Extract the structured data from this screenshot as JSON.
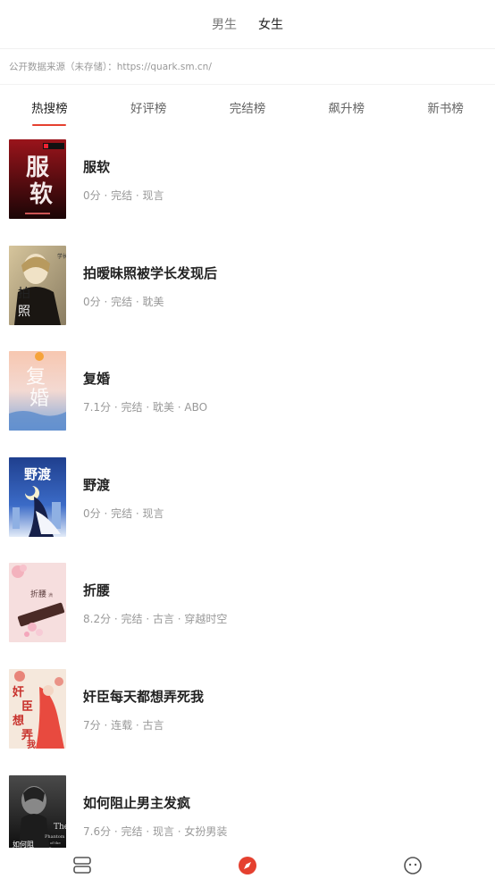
{
  "gender_tabs": [
    {
      "label": "男生",
      "active": false
    },
    {
      "label": "女生",
      "active": true
    }
  ],
  "source_notice": "公开数据来源（未存储）：https://quark.sm.cn/",
  "rank_tabs": [
    {
      "label": "热搜榜",
      "active": true
    },
    {
      "label": "好评榜",
      "active": false
    },
    {
      "label": "完结榜",
      "active": false
    },
    {
      "label": "飙升榜",
      "active": false
    },
    {
      "label": "新书榜",
      "active": false
    }
  ],
  "books": [
    {
      "title": "服软",
      "meta": "0分 · 完结 · 现言",
      "cover_text": "服软",
      "cover_colors": [
        "#8f1016",
        "#1a0405"
      ]
    },
    {
      "title": "拍暧昧照被学长发现后",
      "meta": "0分 · 完结 · 耽美",
      "cover_text": "拍照",
      "cover_colors": [
        "#c9b58d",
        "#2a2418"
      ]
    },
    {
      "title": "复婚",
      "meta": "7.1分 · 完结 · 耽美 · ABO",
      "cover_text": "复婚",
      "cover_colors": [
        "#f5b8a6",
        "#8fb3de"
      ]
    },
    {
      "title": "野渡",
      "meta": "0分 · 完结 · 现言",
      "cover_text": "野渡",
      "cover_colors": [
        "#1a3e8c",
        "#c8d7ef"
      ]
    },
    {
      "title": "折腰",
      "meta": "8.2分 · 完结 · 古言 · 穿越时空",
      "cover_text": "折腰",
      "cover_colors": [
        "#f4d2d2",
        "#f7e7e4"
      ]
    },
    {
      "title": "奸臣每天都想弄死我",
      "meta": "7分 · 连载 · 古言",
      "cover_text": "奸臣想弄我",
      "cover_colors": [
        "#f3e3d5",
        "#d24a43"
      ]
    },
    {
      "title": "如何阻止男主发疯",
      "meta": "7.6分 · 完结 · 现言 · 女扮男装",
      "cover_text": "The Phantom of the Opera",
      "cover_colors": [
        "#3a3a3a",
        "#0c0c0c"
      ]
    }
  ],
  "bottom_nav": [
    {
      "icon": "bookshelf-icon",
      "active": false
    },
    {
      "icon": "discover-compass-icon",
      "active": true
    },
    {
      "icon": "profile-face-icon",
      "active": false
    }
  ],
  "colors": {
    "accent": "#e5402f",
    "text_primary": "#222222",
    "text_secondary": "#999999"
  }
}
